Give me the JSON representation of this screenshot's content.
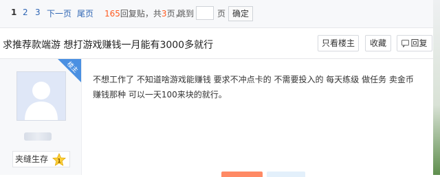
{
  "pagination": {
    "pages": [
      "1",
      "2",
      "3"
    ],
    "next": "下一页",
    "last": "尾页",
    "reply_count": "165",
    "reply_suffix": "回复贴，共",
    "total_pages": "3",
    "pages_unit": "页，",
    "jump_label": "跳到",
    "jump_unit": "页",
    "confirm": "确定"
  },
  "thread": {
    "title": "求推荐款端游 想打游戏赚钱一月能有3000多就行",
    "only_host": "只看楼主",
    "favorite": "收藏",
    "reply": "回复"
  },
  "post": {
    "host_badge": "楼主",
    "rank_label": "夹缝生存",
    "rank_level": "1",
    "content": "不想工作了 不知道啥游戏能赚钱 要求不冲点卡的 不需要投入的 每天练级 做任务 卖金币 赚钱那种 可以一天100来块的就行。"
  },
  "colors": {
    "link": "#2d64b3",
    "accent": "#ff5a1f",
    "badge": "#4a90e2"
  }
}
